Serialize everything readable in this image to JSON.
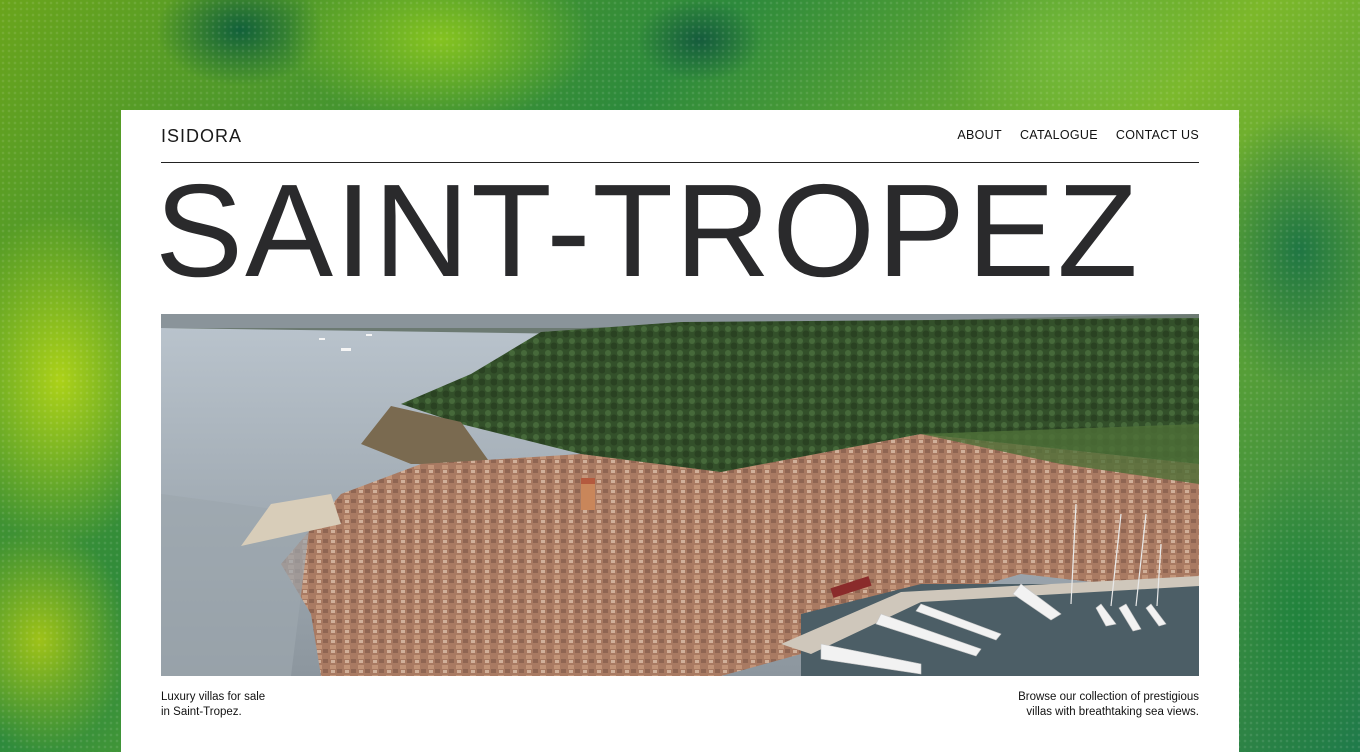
{
  "header": {
    "brand": "ISIDORA",
    "nav": [
      "ABOUT",
      "CATALOGUE",
      "CONTACT US"
    ]
  },
  "hero": {
    "title": "SAINT-TROPEZ"
  },
  "captions": {
    "left_line1": "Luxury villas for sale",
    "left_line2": "in Saint-Tropez.",
    "right_line1": "Browse our collection of prestigious",
    "right_line2": "villas with breathtaking sea views."
  },
  "colors": {
    "card_background": "#ffffff",
    "title_text": "#2a2a2c",
    "body_text": "#111111"
  }
}
